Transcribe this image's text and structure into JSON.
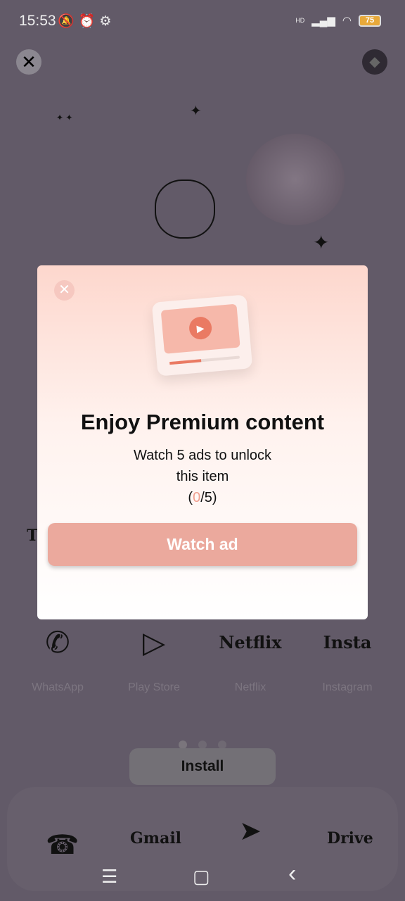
{
  "status": {
    "time": "15:53",
    "battery": "75",
    "network": "HD"
  },
  "header": {
    "close_icon": "close-icon",
    "premium_icon": "diamond-icon"
  },
  "background": {
    "partial_text": "T"
  },
  "modal": {
    "title": "Enjoy Premium content",
    "subtitle_line1": "Watch 5 ads to unlock",
    "subtitle_line2": "this item",
    "progress_open": "(",
    "progress_current": "0",
    "progress_rest": "/5)",
    "watch_button": "Watch ad",
    "accent": "#eba99d"
  },
  "apps": [
    {
      "label": "WhatsApp",
      "icon": "✆"
    },
    {
      "label": "Play Store",
      "icon": "▷"
    },
    {
      "label": "Netflix",
      "icon": "Netflix"
    },
    {
      "label": "Instagram",
      "icon": "Insta"
    }
  ],
  "install_button": "Install",
  "dock": [
    {
      "label": "☎"
    },
    {
      "label": "Gmail"
    },
    {
      "label": "➤"
    },
    {
      "label": "Drive"
    }
  ],
  "nav": {
    "menu": "☰",
    "home": "▢",
    "back": "‹"
  }
}
